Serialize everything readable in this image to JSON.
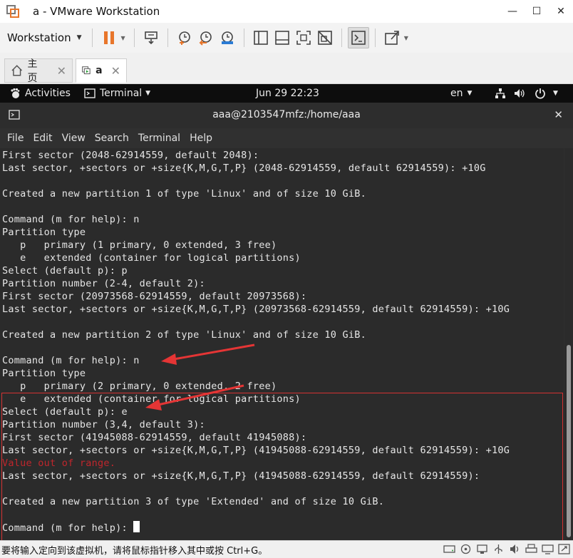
{
  "window": {
    "title": "a - VMware Workstation",
    "minimize_glyph": "—",
    "maximize_glyph": "☐",
    "close_glyph": "✕"
  },
  "toolbar": {
    "workstation_label": "Workstation",
    "icons": [
      "pause-icon",
      "send-ctrl-alt-del-icon",
      "snapshot-take-icon",
      "snapshot-revert-icon",
      "snapshot-manager-icon",
      "library-view-icon",
      "thumbnail-bar-icon",
      "full-screen-icon",
      "unity-icon",
      "console-view-icon",
      "stretch-view-icon"
    ],
    "accent_color": "#e8762b"
  },
  "tabs": [
    {
      "label": "主页",
      "icon": "home-icon",
      "close": "✕"
    },
    {
      "label": "a",
      "icon": "vm-running-icon",
      "close": "✕"
    }
  ],
  "gnome": {
    "activities": "Activities",
    "app_menu": "Terminal",
    "datetime": "Jun 29  22:23",
    "input_source": "en",
    "status_icons": [
      "network-icon",
      "volume-icon",
      "power-icon"
    ]
  },
  "terminal": {
    "title": "aaa@2103547mfz:/home/aaa",
    "close": "✕",
    "menu": [
      "File",
      "Edit",
      "View",
      "Search",
      "Terminal",
      "Help"
    ],
    "lines": [
      {
        "text": "First sector (2048-62914559, default 2048):",
        "error": false
      },
      {
        "text": "Last sector, +sectors or +size{K,M,G,T,P} (2048-62914559, default 62914559): +10G",
        "error": false
      },
      {
        "text": "",
        "error": false
      },
      {
        "text": "Created a new partition 1 of type 'Linux' and of size 10 GiB.",
        "error": false
      },
      {
        "text": "",
        "error": false
      },
      {
        "text": "Command (m for help): n",
        "error": false
      },
      {
        "text": "Partition type",
        "error": false
      },
      {
        "text": "   p   primary (1 primary, 0 extended, 3 free)",
        "error": false
      },
      {
        "text": "   e   extended (container for logical partitions)",
        "error": false
      },
      {
        "text": "Select (default p): p",
        "error": false
      },
      {
        "text": "Partition number (2-4, default 2):",
        "error": false
      },
      {
        "text": "First sector (20973568-62914559, default 20973568):",
        "error": false
      },
      {
        "text": "Last sector, +sectors or +size{K,M,G,T,P} (20973568-62914559, default 62914559): +10G",
        "error": false
      },
      {
        "text": "",
        "error": false
      },
      {
        "text": "Created a new partition 2 of type 'Linux' and of size 10 GiB.",
        "error": false
      },
      {
        "text": "",
        "error": false
      },
      {
        "text": "Command (m for help): n",
        "error": false
      },
      {
        "text": "Partition type",
        "error": false
      },
      {
        "text": "   p   primary (2 primary, 0 extended, 2 free)",
        "error": false
      },
      {
        "text": "   e   extended (container for logical partitions)",
        "error": false
      },
      {
        "text": "Select (default p): e",
        "error": false
      },
      {
        "text": "Partition number (3,4, default 3):",
        "error": false
      },
      {
        "text": "First sector (41945088-62914559, default 41945088):",
        "error": false
      },
      {
        "text": "Last sector, +sectors or +size{K,M,G,T,P} (41945088-62914559, default 62914559): +10G",
        "error": false
      },
      {
        "text": "Value out of range.",
        "error": true
      },
      {
        "text": "Last sector, +sectors or +size{K,M,G,T,P} (41945088-62914559, default 62914559):",
        "error": false
      },
      {
        "text": "",
        "error": false
      },
      {
        "text": "Created a new partition 3 of type 'Extended' and of size 10 GiB.",
        "error": false
      },
      {
        "text": "",
        "error": false
      },
      {
        "text": "Command (m for help): ",
        "error": false,
        "cursor": true
      }
    ],
    "error_color": "#c0262c",
    "annotation_color": "#d63333"
  },
  "statusbar": {
    "hint": "要将输入定向到该虚拟机，请将鼠标指针移入其中或按 Ctrl+G。",
    "device_icons": [
      "hard-disk-icon",
      "cd-dvd-icon",
      "network-adapter-icon",
      "usb-controller-icon",
      "sound-card-icon",
      "printer-icon",
      "display-icon",
      "stretch-icon"
    ]
  }
}
